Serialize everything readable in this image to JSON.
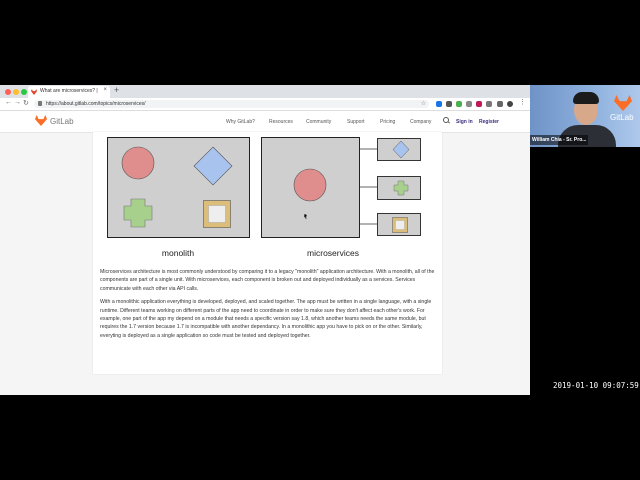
{
  "browser": {
    "tab_title": "What are microservices? | GitLab",
    "new_tab_symbol": "+",
    "close_symbol": "×",
    "url": "https://about.gitlab.com/topics/microservices/",
    "back_symbol": "←",
    "forward_symbol": "→",
    "reload_symbol": "↻",
    "star_symbol": "☆"
  },
  "site": {
    "brand": "GitLab",
    "nav": [
      "Why GitLab?",
      "Resources",
      "Community",
      "Support",
      "Pricing",
      "Company"
    ],
    "sign_in": "Sign in",
    "register": "Register",
    "accent": "#fc6d26"
  },
  "diagram": {
    "monolith_label": "monolith",
    "microservices_label": "microservices",
    "colors": {
      "box_fill": "#cfcfcf",
      "circle": "#e08d8d",
      "diamond": "#a9c3ef",
      "cross": "#a8d08d",
      "square_outline": "#dcbd79",
      "square_fill": "#eeeeee"
    }
  },
  "article": {
    "p1": "Microservices architecture is most commonly understood by comparing it to a legacy \"monolith\" application architecture. With a monolith, all of the components are part of a single unit. With microservices, each component is broken out and deployed individually as a services. Services communicate with each other via API calls.",
    "p2": "With a monolithic application everything is developed, deployed, and scaled together. The app must be written in a single language, with a single runtime. Different teams working on different parts of the app need to coordinate in order to make sure they don't affect each other's work. For example, one part of the app my depend on a module that needs a specific version say 1.8, which another teams needs the same module, but requires the 1.7 version because 1.7 is incompatible with another dependancy. In a monolithic app you have to pick on or the other. Similarly, everyting is deployed as a single application so code must be tested and deployed together."
  },
  "webcam": {
    "name": "William Chia - Sr. Pro...",
    "logo_text": "GitLab"
  },
  "timestamp": "2019-01-10 09:07:59"
}
